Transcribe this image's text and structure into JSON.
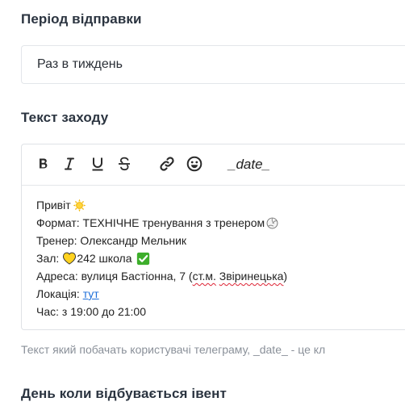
{
  "period": {
    "title": "Період відправки",
    "selected": "Раз в тиждень"
  },
  "text_section": {
    "title": "Текст заходу",
    "toolbar": {
      "date_token": "_date_"
    },
    "lines": {
      "greeting": "Привіт",
      "format": "Формат: ТЕХНІЧНЕ тренування з тренером",
      "trainer": "Тренер: Олександр Мельник",
      "hall_prefix": "Зал:",
      "hall_value": "242 школа",
      "address_prefix": "Адреса: вулиця Бастіонна, 7 (",
      "address_abbr": "ст.м.",
      "address_space": " ",
      "address_station": "Звіринецька",
      "address_suffix": ")",
      "location_prefix": "Локація:",
      "location_link": "тут",
      "time": "Час: з 19:00 до 21:00"
    },
    "helper": "Текст який побачать користувачі телеграму, _date_ - це кл"
  },
  "day": {
    "title": "День коли відбувається івент"
  },
  "icons": {
    "bold": "bold-icon",
    "italic": "italic-icon",
    "underline": "underline-icon",
    "strike": "strikethrough-icon",
    "link": "link-icon",
    "emoji": "emoji-icon",
    "sun": "sun-emoji",
    "ball": "volleyball-emoji",
    "heart": "yellow-heart-emoji",
    "check": "check-mark-emoji"
  }
}
